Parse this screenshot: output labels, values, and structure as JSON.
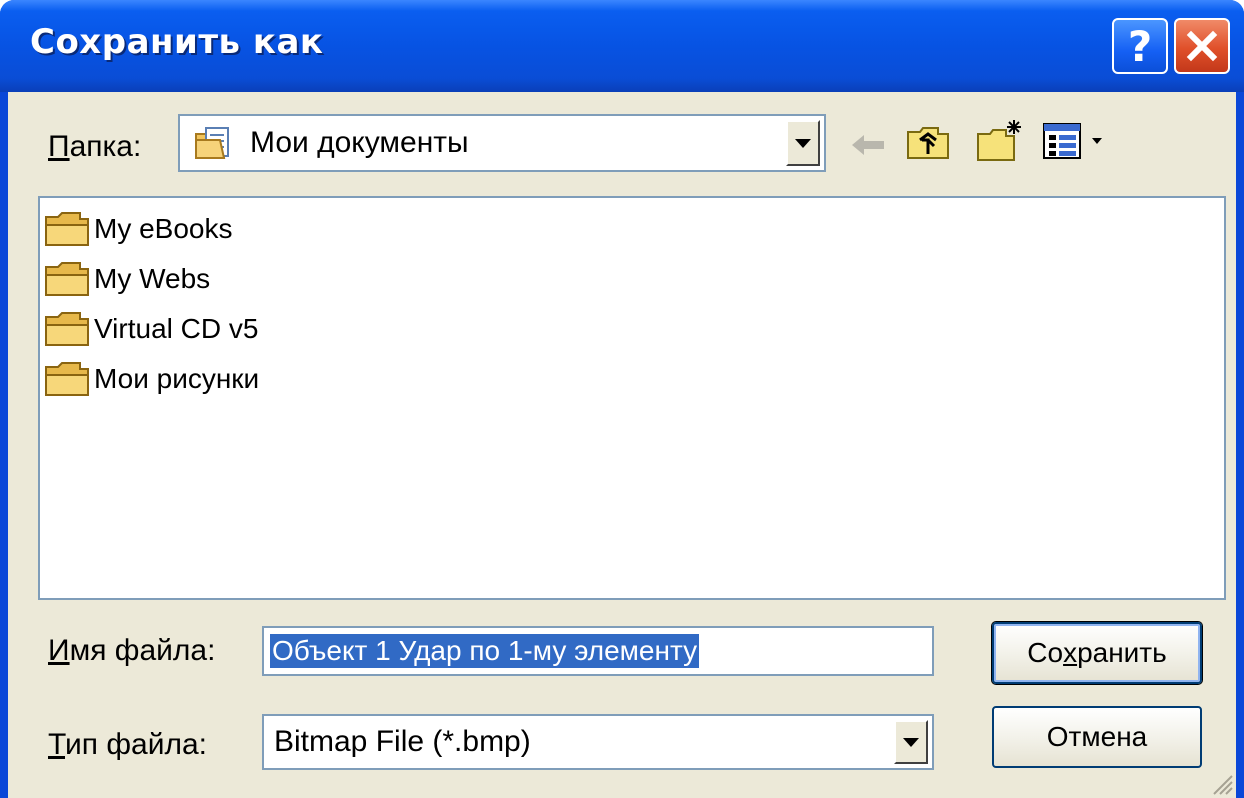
{
  "window": {
    "title": "Сохранить как",
    "help_glyph": "?",
    "close_glyph": "✕"
  },
  "toolbar": {
    "folder_label_access_key": "П",
    "folder_label_rest": "апка:",
    "folder_value": "Мои документы",
    "icons": [
      "back-arrow-icon",
      "up-folder-icon",
      "new-folder-icon",
      "view-menu-icon"
    ]
  },
  "file_list": {
    "items": [
      {
        "label": "My eBooks",
        "icon": "folder-icon"
      },
      {
        "label": "My Webs",
        "icon": "folder-icon"
      },
      {
        "label": "Virtual CD v5",
        "icon": "folder-icon"
      },
      {
        "label": "Мои рисунки",
        "icon": "folder-icon"
      }
    ]
  },
  "form": {
    "filename_label_access_key": "И",
    "filename_label_rest": "мя файла:",
    "filename_value": "Объект 1 Удар по 1-му элементу",
    "filetype_label_access_key": "Т",
    "filetype_label_rest": "ип файла:",
    "filetype_value": "Bitmap File (*.bmp)"
  },
  "buttons": {
    "save_pre": "Со",
    "save_key": "х",
    "save_post": "ранить",
    "cancel_label": "Отмена"
  },
  "colors": {
    "titlebar": "#0753e3",
    "dialog_bg": "#ece9d8",
    "selection": "#316ac5",
    "close_button": "#e0502a"
  }
}
